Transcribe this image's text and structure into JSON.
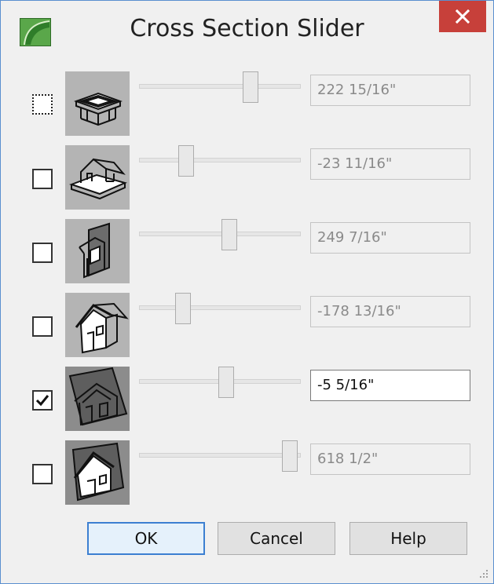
{
  "window": {
    "title": "Cross Section Slider"
  },
  "rows": [
    {
      "checked": false,
      "slider_fraction": 0.69,
      "value": "222 15/16\"",
      "active": false,
      "icon": "roof-plan-icon"
    },
    {
      "checked": false,
      "slider_fraction": 0.29,
      "value": "-23 11/16\"",
      "active": false,
      "icon": "house-3d-icon"
    },
    {
      "checked": false,
      "slider_fraction": 0.56,
      "value": "249 7/16\"",
      "active": false,
      "icon": "wall-elevation-icon"
    },
    {
      "checked": false,
      "slider_fraction": 0.27,
      "value": "-178 13/16\"",
      "active": false,
      "icon": "house-side-icon"
    },
    {
      "checked": true,
      "slider_fraction": 0.54,
      "value": "-5 5/16\"",
      "active": true,
      "icon": "house-section-icon"
    },
    {
      "checked": false,
      "slider_fraction": 0.93,
      "value": "618 1/2\"",
      "active": false,
      "icon": "house-front-icon"
    }
  ],
  "buttons": {
    "ok": "OK",
    "cancel": "Cancel",
    "help": "Help"
  },
  "colors": {
    "close": "#c7403a",
    "accent": "#3c7fd1"
  }
}
